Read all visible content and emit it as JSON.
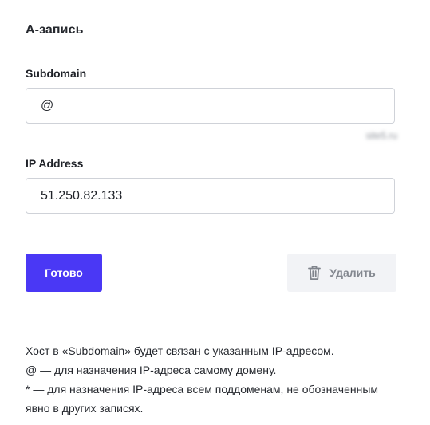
{
  "header": {
    "title": "А-запись"
  },
  "form": {
    "subdomain": {
      "label": "Subdomain",
      "value": "@",
      "domain_hint": "site5.ru"
    },
    "ip_address": {
      "label": "IP Address",
      "value": "51.250.82.133"
    }
  },
  "actions": {
    "done_label": "Готово",
    "delete_label": "Удалить",
    "delete_icon": "trash-icon"
  },
  "help": {
    "lines": [
      "Хост в «Subdomain» будет связан с указанным IP-адресом.",
      "@ — для назначения IP-адреса самому домену.",
      "* — для назначения IP-адреса всем поддоменам, не обозначенным явно в других записях."
    ]
  },
  "colors": {
    "primary": "#4a38f5",
    "secondary_bg": "#f2f3f6",
    "border": "#cfd2d8"
  }
}
